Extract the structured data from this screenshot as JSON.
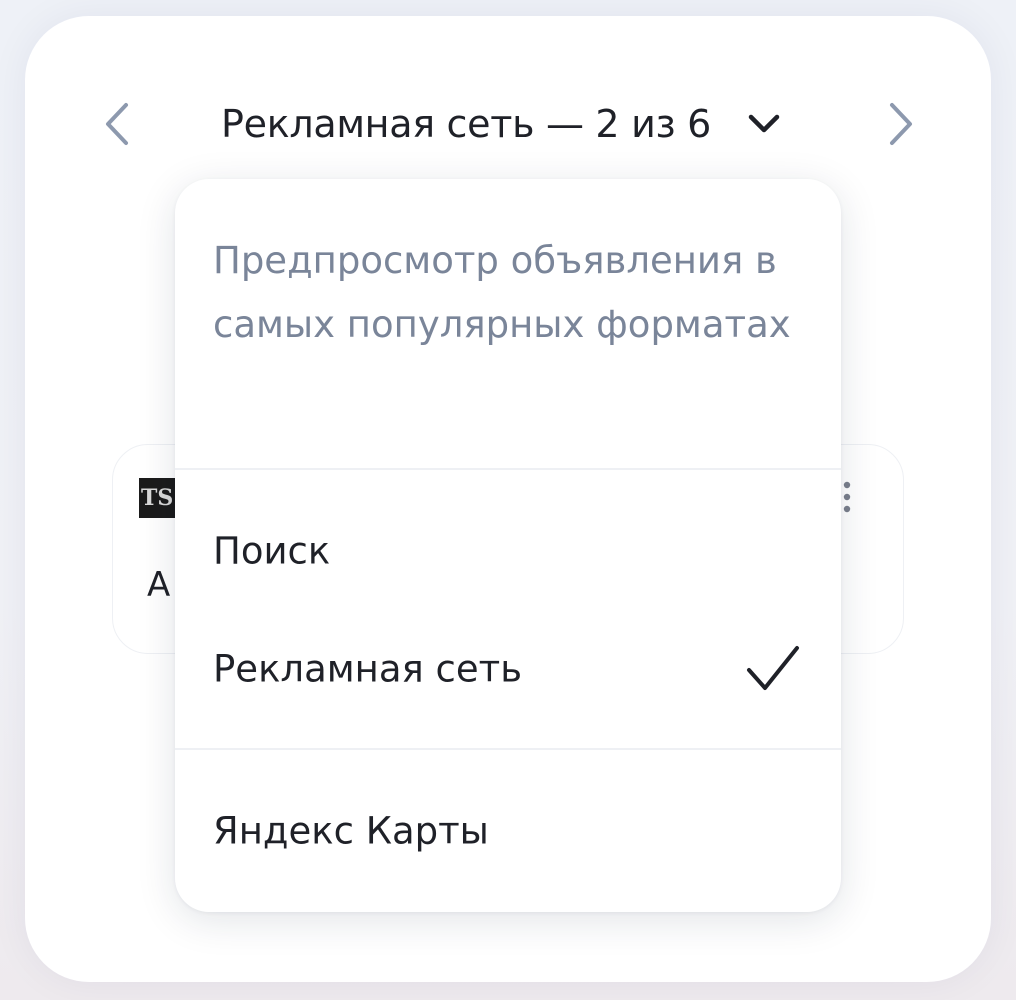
{
  "navigator": {
    "title": "Рекламная сеть — 2 из 6",
    "prev_icon": "chevron-left-icon",
    "next_icon": "chevron-right-icon",
    "dropdown_icon": "chevron-down-icon"
  },
  "ad_preview": {
    "favicon_text": "TS",
    "text_visible": "А",
    "more_icon": "more-vertical-icon"
  },
  "dropdown": {
    "description": "Предпросмотр объявления в самых популярных форматах",
    "options": [
      {
        "label": "Поиск",
        "selected": false
      },
      {
        "label": "Рекламная сеть",
        "selected": true
      },
      {
        "label": "Яндекс Карты",
        "selected": false
      }
    ],
    "check_icon": "check-icon"
  },
  "colors": {
    "background": "#eef1f7",
    "card": "#ffffff",
    "text_primary": "#1f2128",
    "text_secondary": "#7a8599",
    "arrow": "#8d99ae",
    "divider": "#eef0f4"
  }
}
